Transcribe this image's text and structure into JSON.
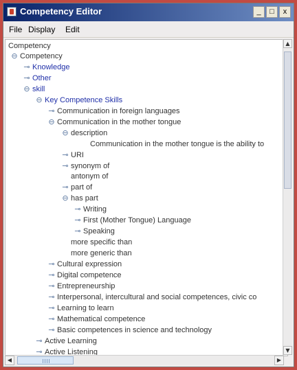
{
  "window": {
    "title": "Competency Editor",
    "controls": {
      "minimize": "_",
      "maximize": "□",
      "close": "x"
    }
  },
  "menu": [
    {
      "label": "File"
    },
    {
      "label": "Display"
    },
    {
      "label": "Edit"
    }
  ],
  "tree": {
    "root_label": "Competency",
    "nodes": [
      {
        "label": "Competency",
        "toggle": "⊖"
      },
      {
        "label": "Knowledge",
        "toggle": "⊸",
        "link": true
      },
      {
        "label": "Other",
        "toggle": "⊸",
        "link": true
      },
      {
        "label": "skill",
        "toggle": "⊖",
        "link": true
      },
      {
        "label": "Key Competence Skills",
        "toggle": "⊖",
        "link": true
      },
      {
        "label": "Communication in foreign languages",
        "toggle": "⊸"
      },
      {
        "label": "Communication in the mother tongue",
        "toggle": "⊖"
      },
      {
        "label": "description",
        "toggle": "⊖"
      },
      {
        "label": "Communication in the mother tongue is the ability to",
        "toggle": ""
      },
      {
        "label": "URI",
        "toggle": "⊸"
      },
      {
        "label": "synonym of",
        "toggle": "⊸"
      },
      {
        "label": "antonym of",
        "toggle": ""
      },
      {
        "label": "part of",
        "toggle": "⊸"
      },
      {
        "label": "has part",
        "toggle": "⊖"
      },
      {
        "label": "Writing",
        "toggle": "⊸"
      },
      {
        "label": "First (Mother Tongue) Language",
        "toggle": "⊸"
      },
      {
        "label": "Speaking",
        "toggle": "⊸"
      },
      {
        "label": "more specific than",
        "toggle": ""
      },
      {
        "label": "more generic than",
        "toggle": ""
      },
      {
        "label": "Cultural expression",
        "toggle": "⊸"
      },
      {
        "label": "Digital competence",
        "toggle": "⊸"
      },
      {
        "label": "Entrepreneurship",
        "toggle": "⊸"
      },
      {
        "label": "Interpersonal, intercultural and social competences, civic co",
        "toggle": "⊸"
      },
      {
        "label": "Learning to learn",
        "toggle": "⊸"
      },
      {
        "label": "Mathematical competence",
        "toggle": "⊸"
      },
      {
        "label": "Basic competences in science and technology",
        "toggle": "⊸"
      },
      {
        "label": "Active Learning",
        "toggle": "⊸"
      },
      {
        "label": "Active Listening",
        "toggle": "⊸"
      }
    ]
  },
  "scroll": {
    "up": "▲",
    "down": "▼",
    "left": "◀",
    "right": "▶"
  }
}
